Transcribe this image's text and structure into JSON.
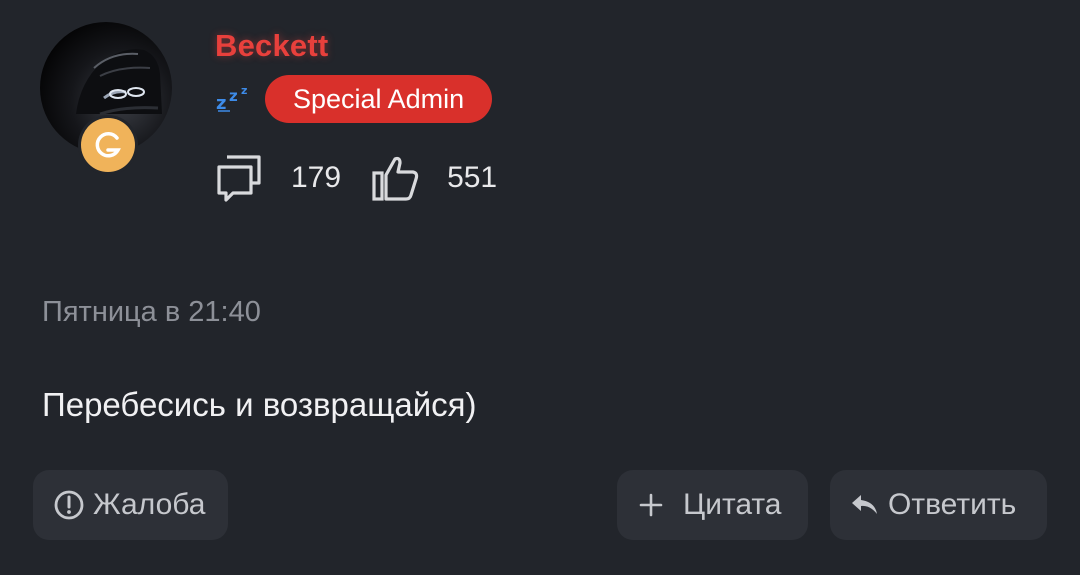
{
  "author": {
    "username": "Beckett",
    "role_badge": "Special Admin",
    "status_icon": "sleep-zzz-icon",
    "rank_icon": "rank-badge-icon",
    "messages_count": "179",
    "likes_count": "551"
  },
  "post": {
    "date": "Пятница в 21:40",
    "message": "Перебесись и возвращайся)"
  },
  "actions": {
    "report_label": "Жалоба",
    "quote_label": "Цитата",
    "reply_label": "Ответить"
  },
  "colors": {
    "background": "#22252b",
    "username": "#e8403c",
    "role_badge": "#d9302b",
    "button_bg": "#2d3037",
    "muted_text": "#8d9098",
    "rank_badge": "#f0b35a"
  }
}
